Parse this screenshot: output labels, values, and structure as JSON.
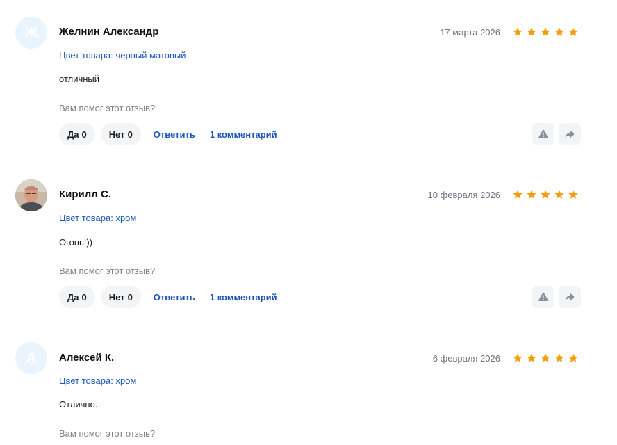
{
  "reviews": [
    {
      "avatar_letter": "Ж",
      "name": "Желнин Александр",
      "date": "17 марта 2026",
      "rating": 5,
      "variant": "Цвет товара: черный матовый",
      "text": "отличный",
      "helpful_question": "Вам помог этот отзыв?",
      "yes_label": "Да",
      "yes_count": "0",
      "no_label": "Нет",
      "no_count": "0",
      "reply_label": "Ответить",
      "comments_label": "1 комментарий"
    },
    {
      "avatar_letter": "",
      "name": "Кирилл С.",
      "date": "10 февраля 2026",
      "rating": 5,
      "variant": "Цвет товара: хром",
      "text": "Огонь!))",
      "helpful_question": "Вам помог этот отзыв?",
      "yes_label": "Да",
      "yes_count": "0",
      "no_label": "Нет",
      "no_count": "0",
      "reply_label": "Ответить",
      "comments_label": "1 комментарий"
    },
    {
      "avatar_letter": "А",
      "name": "Алексей К.",
      "date": "6 февраля 2026",
      "rating": 5,
      "variant": "Цвет товара: хром",
      "text": "Отлично.",
      "helpful_question": "Вам помог этот отзыв?"
    }
  ],
  "colors": {
    "star": "#f59e0b",
    "link": "#1a56b8",
    "muted": "#7b8089",
    "pill_bg": "#f3f4f6",
    "avatar_bg": "#eaf4fd"
  },
  "icons": {
    "report": "warning-triangle-icon",
    "share": "share-arrow-icon",
    "star": "star-icon"
  }
}
